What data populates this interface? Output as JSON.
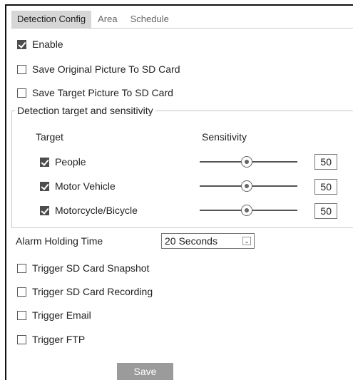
{
  "tabs": [
    "Detection Config",
    "Area",
    "Schedule"
  ],
  "enable": {
    "label": "Enable",
    "checked": true
  },
  "save_original": {
    "label": "Save Original Picture To SD Card",
    "checked": false
  },
  "save_target": {
    "label": "Save Target Picture To SD Card",
    "checked": false
  },
  "detection": {
    "legend": "Detection target and sensitivity",
    "target_header": "Target",
    "sensitivity_header": "Sensitivity",
    "targets": [
      {
        "label": "People",
        "checked": true,
        "sensitivity": "50"
      },
      {
        "label": "Motor Vehicle",
        "checked": true,
        "sensitivity": "50"
      },
      {
        "label": "Motorcycle/Bicycle",
        "checked": true,
        "sensitivity": "50"
      }
    ]
  },
  "alarm_holding": {
    "label": "Alarm Holding Time",
    "value": "20 Seconds"
  },
  "triggers": [
    {
      "label": "Trigger SD Card Snapshot",
      "checked": false
    },
    {
      "label": "Trigger SD Card Recording",
      "checked": false
    },
    {
      "label": "Trigger Email",
      "checked": false
    },
    {
      "label": "Trigger FTP",
      "checked": false
    }
  ],
  "save_label": "Save",
  "colors": {
    "active_tab": "#d6d6d6",
    "save_button": "#9b9b9b",
    "checkbox_checked": "#4d4d4d"
  }
}
